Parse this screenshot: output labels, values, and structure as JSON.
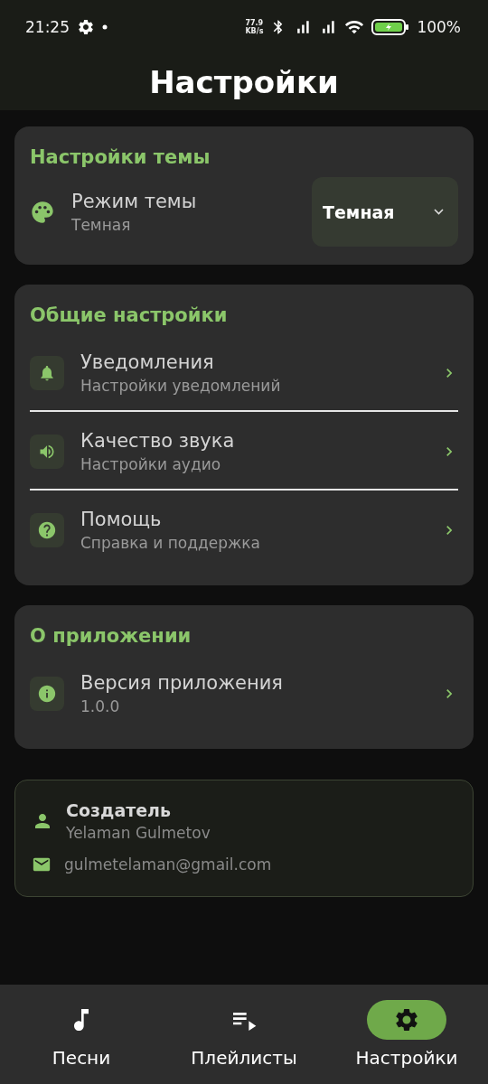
{
  "status_bar": {
    "time": "21:25",
    "speed_value": "77.9",
    "speed_unit": "KB/s",
    "battery": "100%"
  },
  "header": {
    "title": "Настройки"
  },
  "theme_card": {
    "title": "Настройки темы",
    "row": {
      "label": "Режим темы",
      "value": "Темная"
    },
    "dropdown": {
      "value": "Темная"
    }
  },
  "general_card": {
    "title": "Общие настройки",
    "items": [
      {
        "label": "Уведомления",
        "subtitle": "Настройки уведомлений"
      },
      {
        "label": "Качество звука",
        "subtitle": "Настройки аудио"
      },
      {
        "label": "Помощь",
        "subtitle": "Справка и поддержка"
      }
    ]
  },
  "about_card": {
    "title": "О приложении",
    "items": [
      {
        "label": "Версия приложения",
        "subtitle": "1.0.0"
      }
    ]
  },
  "creator_card": {
    "label": "Создатель",
    "name": "Yelaman Gulmetov",
    "email": "gulmetelaman@gmail.com"
  },
  "bottom_nav": [
    {
      "label": "Песни",
      "selected": false
    },
    {
      "label": "Плейлисты",
      "selected": false
    },
    {
      "label": "Настройки",
      "selected": true
    }
  ]
}
